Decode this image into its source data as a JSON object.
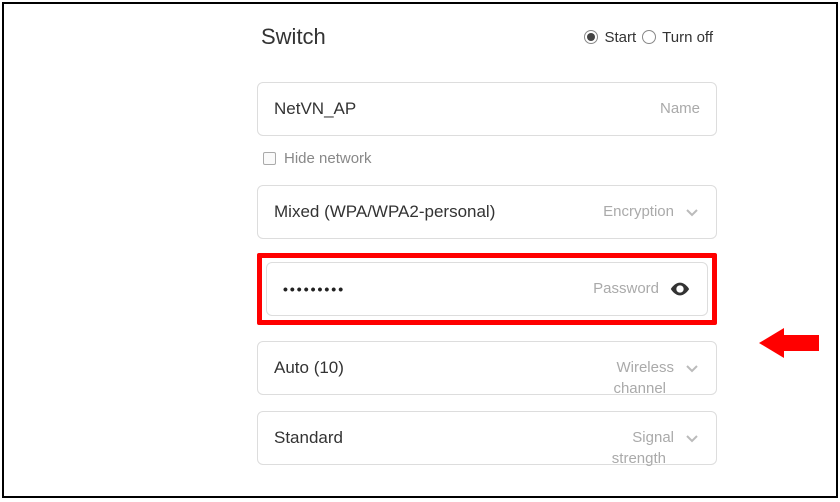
{
  "header": {
    "title": "Switch",
    "options": [
      "Start",
      "Turn off"
    ],
    "selected": "Start"
  },
  "fields": {
    "name": {
      "value": "NetVN_AP",
      "label": "Name"
    },
    "hide": {
      "label": "Hide network",
      "checked": false
    },
    "encryption": {
      "value": "Mixed (WPA/WPA2-personal)",
      "label": "Encryption"
    },
    "password": {
      "masked": "•••••••••",
      "label": "Password"
    },
    "channel": {
      "value": "Auto (10)",
      "label": "Wireless",
      "label2": "channel"
    },
    "signal": {
      "value": "Standard",
      "label": "Signal",
      "label2": "strength"
    }
  },
  "annotation": {
    "highlight_color": "#ff0000",
    "arrow_color": "#ff0000",
    "target": "password-field"
  }
}
